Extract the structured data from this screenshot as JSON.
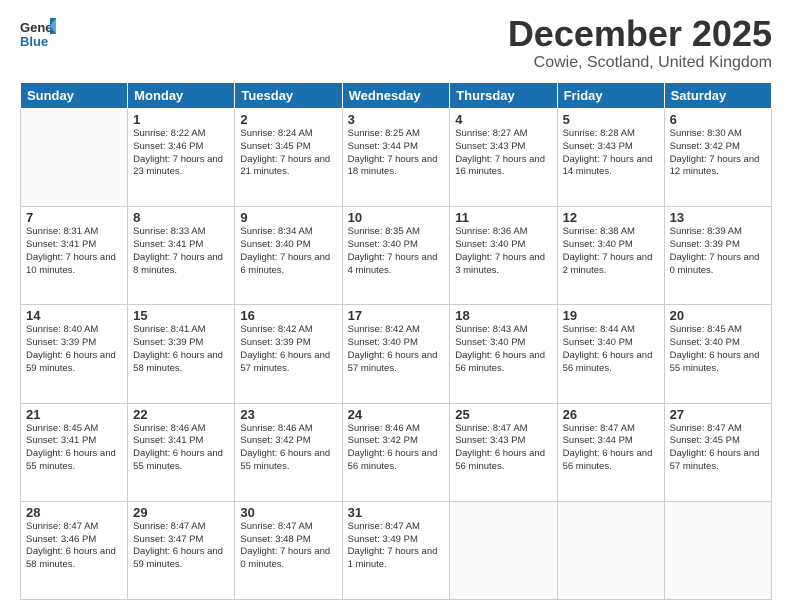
{
  "header": {
    "logo_general": "General",
    "logo_blue": "Blue",
    "month_title": "December 2025",
    "location": "Cowie, Scotland, United Kingdom"
  },
  "days_of_week": [
    "Sunday",
    "Monday",
    "Tuesday",
    "Wednesday",
    "Thursday",
    "Friday",
    "Saturday"
  ],
  "weeks": [
    [
      {
        "day": "",
        "sunrise": "",
        "sunset": "",
        "daylight": ""
      },
      {
        "day": "1",
        "sunrise": "Sunrise: 8:22 AM",
        "sunset": "Sunset: 3:46 PM",
        "daylight": "Daylight: 7 hours and 23 minutes."
      },
      {
        "day": "2",
        "sunrise": "Sunrise: 8:24 AM",
        "sunset": "Sunset: 3:45 PM",
        "daylight": "Daylight: 7 hours and 21 minutes."
      },
      {
        "day": "3",
        "sunrise": "Sunrise: 8:25 AM",
        "sunset": "Sunset: 3:44 PM",
        "daylight": "Daylight: 7 hours and 18 minutes."
      },
      {
        "day": "4",
        "sunrise": "Sunrise: 8:27 AM",
        "sunset": "Sunset: 3:43 PM",
        "daylight": "Daylight: 7 hours and 16 minutes."
      },
      {
        "day": "5",
        "sunrise": "Sunrise: 8:28 AM",
        "sunset": "Sunset: 3:43 PM",
        "daylight": "Daylight: 7 hours and 14 minutes."
      },
      {
        "day": "6",
        "sunrise": "Sunrise: 8:30 AM",
        "sunset": "Sunset: 3:42 PM",
        "daylight": "Daylight: 7 hours and 12 minutes."
      }
    ],
    [
      {
        "day": "7",
        "sunrise": "Sunrise: 8:31 AM",
        "sunset": "Sunset: 3:41 PM",
        "daylight": "Daylight: 7 hours and 10 minutes."
      },
      {
        "day": "8",
        "sunrise": "Sunrise: 8:33 AM",
        "sunset": "Sunset: 3:41 PM",
        "daylight": "Daylight: 7 hours and 8 minutes."
      },
      {
        "day": "9",
        "sunrise": "Sunrise: 8:34 AM",
        "sunset": "Sunset: 3:40 PM",
        "daylight": "Daylight: 7 hours and 6 minutes."
      },
      {
        "day": "10",
        "sunrise": "Sunrise: 8:35 AM",
        "sunset": "Sunset: 3:40 PM",
        "daylight": "Daylight: 7 hours and 4 minutes."
      },
      {
        "day": "11",
        "sunrise": "Sunrise: 8:36 AM",
        "sunset": "Sunset: 3:40 PM",
        "daylight": "Daylight: 7 hours and 3 minutes."
      },
      {
        "day": "12",
        "sunrise": "Sunrise: 8:38 AM",
        "sunset": "Sunset: 3:40 PM",
        "daylight": "Daylight: 7 hours and 2 minutes."
      },
      {
        "day": "13",
        "sunrise": "Sunrise: 8:39 AM",
        "sunset": "Sunset: 3:39 PM",
        "daylight": "Daylight: 7 hours and 0 minutes."
      }
    ],
    [
      {
        "day": "14",
        "sunrise": "Sunrise: 8:40 AM",
        "sunset": "Sunset: 3:39 PM",
        "daylight": "Daylight: 6 hours and 59 minutes."
      },
      {
        "day": "15",
        "sunrise": "Sunrise: 8:41 AM",
        "sunset": "Sunset: 3:39 PM",
        "daylight": "Daylight: 6 hours and 58 minutes."
      },
      {
        "day": "16",
        "sunrise": "Sunrise: 8:42 AM",
        "sunset": "Sunset: 3:39 PM",
        "daylight": "Daylight: 6 hours and 57 minutes."
      },
      {
        "day": "17",
        "sunrise": "Sunrise: 8:42 AM",
        "sunset": "Sunset: 3:40 PM",
        "daylight": "Daylight: 6 hours and 57 minutes."
      },
      {
        "day": "18",
        "sunrise": "Sunrise: 8:43 AM",
        "sunset": "Sunset: 3:40 PM",
        "daylight": "Daylight: 6 hours and 56 minutes."
      },
      {
        "day": "19",
        "sunrise": "Sunrise: 8:44 AM",
        "sunset": "Sunset: 3:40 PM",
        "daylight": "Daylight: 6 hours and 56 minutes."
      },
      {
        "day": "20",
        "sunrise": "Sunrise: 8:45 AM",
        "sunset": "Sunset: 3:40 PM",
        "daylight": "Daylight: 6 hours and 55 minutes."
      }
    ],
    [
      {
        "day": "21",
        "sunrise": "Sunrise: 8:45 AM",
        "sunset": "Sunset: 3:41 PM",
        "daylight": "Daylight: 6 hours and 55 minutes."
      },
      {
        "day": "22",
        "sunrise": "Sunrise: 8:46 AM",
        "sunset": "Sunset: 3:41 PM",
        "daylight": "Daylight: 6 hours and 55 minutes."
      },
      {
        "day": "23",
        "sunrise": "Sunrise: 8:46 AM",
        "sunset": "Sunset: 3:42 PM",
        "daylight": "Daylight: 6 hours and 55 minutes."
      },
      {
        "day": "24",
        "sunrise": "Sunrise: 8:46 AM",
        "sunset": "Sunset: 3:42 PM",
        "daylight": "Daylight: 6 hours and 56 minutes."
      },
      {
        "day": "25",
        "sunrise": "Sunrise: 8:47 AM",
        "sunset": "Sunset: 3:43 PM",
        "daylight": "Daylight: 6 hours and 56 minutes."
      },
      {
        "day": "26",
        "sunrise": "Sunrise: 8:47 AM",
        "sunset": "Sunset: 3:44 PM",
        "daylight": "Daylight: 6 hours and 56 minutes."
      },
      {
        "day": "27",
        "sunrise": "Sunrise: 8:47 AM",
        "sunset": "Sunset: 3:45 PM",
        "daylight": "Daylight: 6 hours and 57 minutes."
      }
    ],
    [
      {
        "day": "28",
        "sunrise": "Sunrise: 8:47 AM",
        "sunset": "Sunset: 3:46 PM",
        "daylight": "Daylight: 6 hours and 58 minutes."
      },
      {
        "day": "29",
        "sunrise": "Sunrise: 8:47 AM",
        "sunset": "Sunset: 3:47 PM",
        "daylight": "Daylight: 6 hours and 59 minutes."
      },
      {
        "day": "30",
        "sunrise": "Sunrise: 8:47 AM",
        "sunset": "Sunset: 3:48 PM",
        "daylight": "Daylight: 7 hours and 0 minutes."
      },
      {
        "day": "31",
        "sunrise": "Sunrise: 8:47 AM",
        "sunset": "Sunset: 3:49 PM",
        "daylight": "Daylight: 7 hours and 1 minute."
      },
      {
        "day": "",
        "sunrise": "",
        "sunset": "",
        "daylight": ""
      },
      {
        "day": "",
        "sunrise": "",
        "sunset": "",
        "daylight": ""
      },
      {
        "day": "",
        "sunrise": "",
        "sunset": "",
        "daylight": ""
      }
    ]
  ]
}
